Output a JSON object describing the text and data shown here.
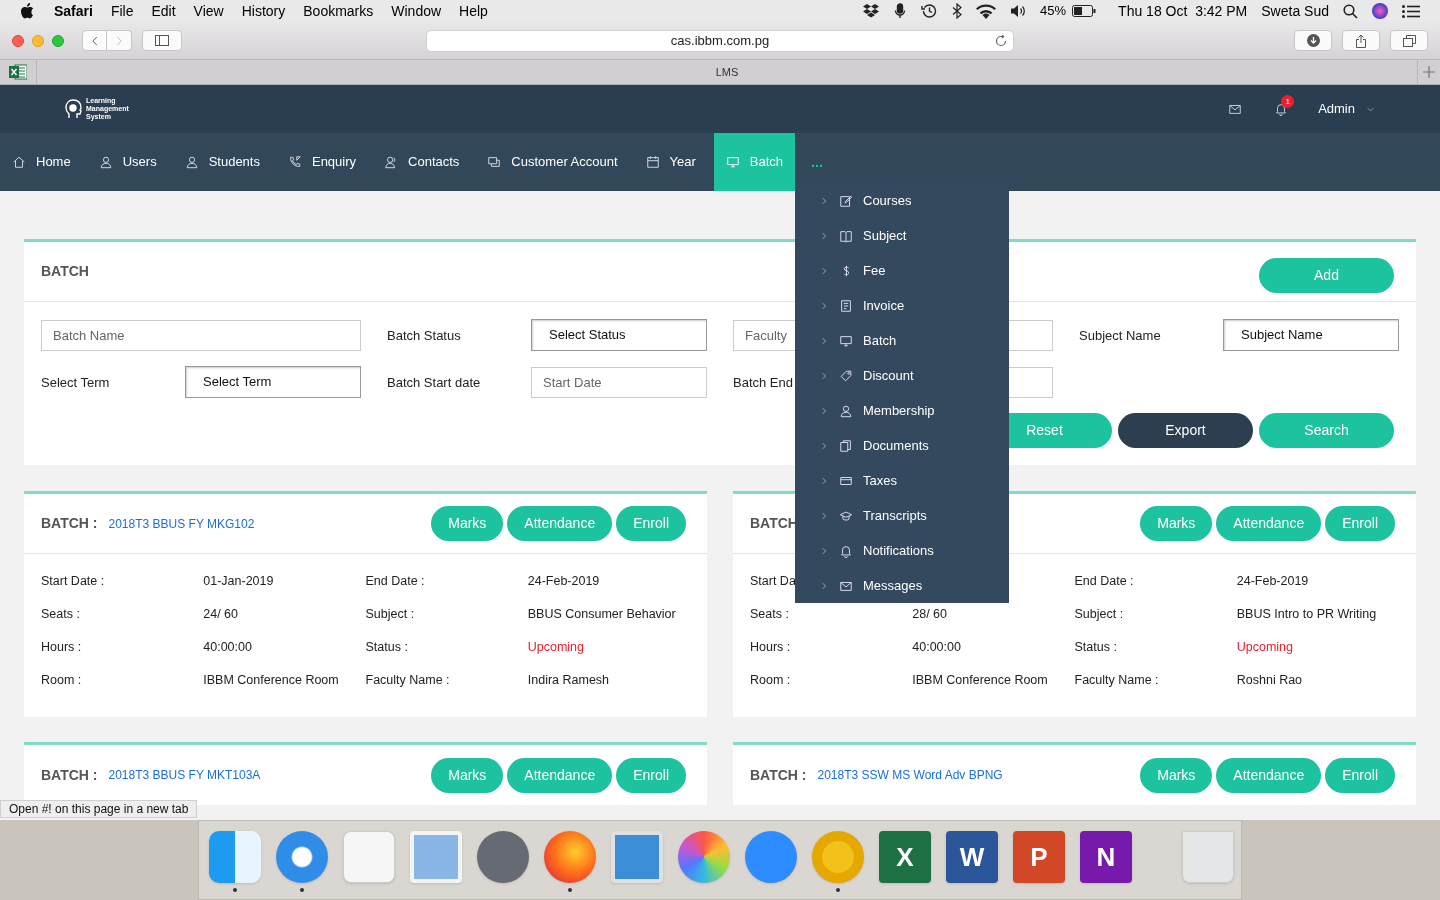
{
  "menubar": {
    "app": "Safari",
    "menus": [
      "File",
      "Edit",
      "View",
      "History",
      "Bookmarks",
      "Window",
      "Help"
    ],
    "battery": "45%",
    "clock": "Thu 18 Oct  3:42 PM",
    "user": "Sweta Sud"
  },
  "browser": {
    "url": "cas.ibbm.com.pg",
    "tab_title": "LMS",
    "status_text": "Open #! on this page in a new tab"
  },
  "header": {
    "logo_lines": [
      "Learning",
      "Management",
      "System"
    ],
    "notification_count": "1",
    "user_menu": "Admin"
  },
  "nav": [
    {
      "label": "Home",
      "selected": false
    },
    {
      "label": "Users",
      "selected": false
    },
    {
      "label": "Students",
      "selected": false
    },
    {
      "label": "Enquiry",
      "selected": false
    },
    {
      "label": "Contacts",
      "selected": false
    },
    {
      "label": "Customer Account",
      "selected": false
    },
    {
      "label": "Year",
      "selected": false
    },
    {
      "label": "Batch",
      "selected": true
    }
  ],
  "nav_more": "...",
  "dropdown": [
    "Courses",
    "Subject",
    "Fee",
    "Invoice",
    "Batch",
    "Discount",
    "Membership",
    "Documents",
    "Taxes",
    "Transcripts",
    "Notifications",
    "Messages"
  ],
  "filter_panel": {
    "title": "BATCH",
    "add_button": "Add",
    "rows": [
      [
        {
          "kind": "input",
          "placeholder": "Batch Name"
        },
        {
          "kind": "select",
          "label": "Batch Status",
          "value": "Select Status"
        },
        {
          "kind": "input",
          "placeholder": "Faculty"
        },
        {
          "kind": "select",
          "label": "Subject Name",
          "value": "Subject Name"
        }
      ],
      [
        {
          "kind": "select",
          "label": "Select Term",
          "value": "Select Term"
        },
        {
          "kind": "input",
          "label": "Batch Start date",
          "placeholder": "Start Date"
        },
        {
          "kind": "input",
          "label": "Batch End"
        }
      ]
    ],
    "buttons": [
      {
        "label": "Reset",
        "kind": "primary"
      },
      {
        "label": "Export",
        "kind": "dark"
      },
      {
        "label": "Search",
        "kind": "primary"
      }
    ]
  },
  "batches": [
    {
      "label": "BATCH :",
      "code": "2018T3 BBUS FY MKG102",
      "buttons": [
        "Marks",
        "Attendance",
        "Enroll"
      ],
      "details": [
        [
          {
            "label": "Start Date :",
            "value": "01-Jan-2019"
          },
          {
            "label": "End Date :",
            "value": "24-Feb-2019"
          }
        ],
        [
          {
            "label": "Seats :",
            "value": "24/ 60"
          },
          {
            "label": "Subject :",
            "value": "BBUS Consumer Behavior"
          }
        ],
        [
          {
            "label": "Hours :",
            "value": "40:00:00"
          },
          {
            "label": "Status :",
            "value": "Upcoming",
            "kind": "status"
          }
        ],
        [
          {
            "label": "Room :",
            "value": "IBBM Conference Room"
          },
          {
            "label": "Faculty Name :",
            "value": "Indira Ramesh"
          }
        ]
      ]
    },
    {
      "label": "BATCH",
      "buttons": [
        "Marks",
        "Attendance",
        "Enroll"
      ],
      "details": [
        [
          {
            "label": "Start Da"
          },
          {
            "label": "End Date :",
            "value": "24-Feb-2019"
          }
        ],
        [
          {
            "label": "Seats :",
            "value": "28/ 60"
          },
          {
            "label": "Subject :",
            "value": "BBUS Intro to PR Writing"
          }
        ],
        [
          {
            "label": "Hours :",
            "value": "40:00:00"
          },
          {
            "label": "Status :",
            "value": "Upcoming",
            "kind": "status"
          }
        ],
        [
          {
            "label": "Room :",
            "value": "IBBM Conference Room"
          },
          {
            "label": "Faculty Name :",
            "value": "Roshni Rao"
          }
        ]
      ]
    },
    {
      "label": "BATCH :",
      "code": "2018T3 BBUS FY MKT103A",
      "buttons": [
        "Marks",
        "Attendance",
        "Enroll"
      ]
    },
    {
      "label": "BATCH :",
      "code": "2018T3 SSW MS Word Adv BPNG",
      "buttons": [
        "Marks",
        "Attendance",
        "Enroll"
      ]
    }
  ],
  "dock": [
    {
      "running": true
    },
    {
      "running": true
    },
    {
      "running": false
    },
    {
      "running": false
    },
    {
      "running": false
    },
    {
      "running": true
    },
    {
      "running": false
    },
    {
      "running": false
    },
    {
      "running": false
    },
    {
      "running": true
    },
    {
      "running": false,
      "letter": "X"
    },
    {
      "running": false,
      "letter": "W"
    },
    {
      "running": false,
      "letter": "P"
    },
    {
      "running": false,
      "letter": "N"
    },
    {
      "running": false
    }
  ]
}
